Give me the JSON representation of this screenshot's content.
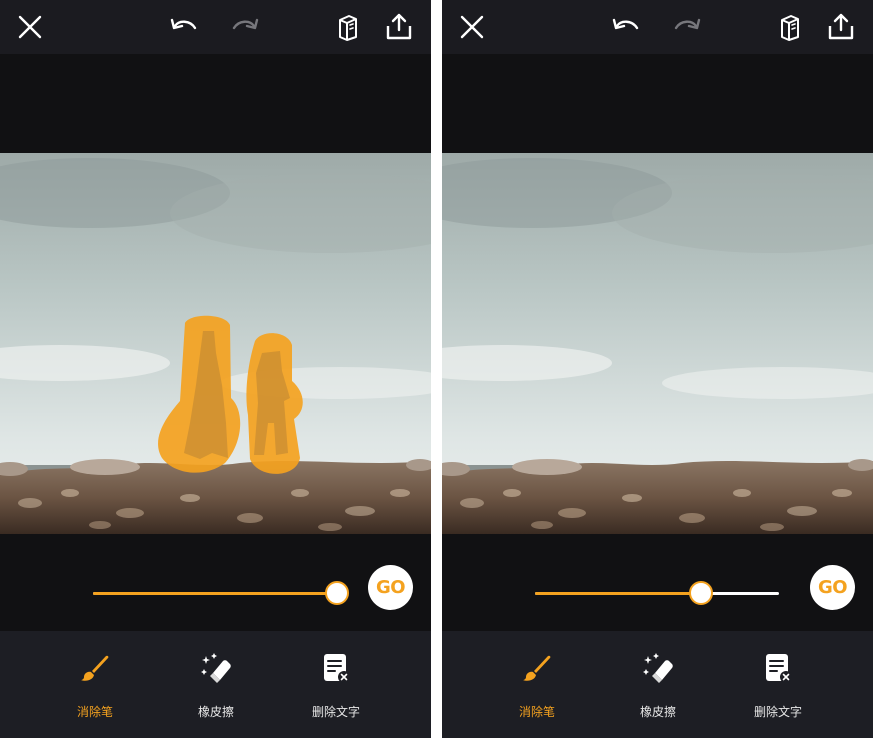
{
  "colors": {
    "accent": "#f4a21f",
    "toolbar_bg": "#1d1e24",
    "topbar_bg": "#1b1b20",
    "canvas_bg": "#111113"
  },
  "icons": {
    "close": "close-icon",
    "undo": "undo-icon",
    "redo": "redo-icon",
    "compare": "book-compare-icon",
    "share": "share-upload-icon",
    "brush": "brush-icon",
    "eraser": "eraser-magic-icon",
    "text": "remove-text-icon"
  },
  "panels": [
    {
      "go_label": "GO",
      "slider_fraction": 1.0,
      "tools": [
        {
          "label": "消除笔",
          "active": true
        },
        {
          "label": "橡皮擦",
          "active": false
        },
        {
          "label": "删除文字",
          "active": false
        }
      ]
    },
    {
      "go_label": "GO",
      "slider_fraction": 0.68,
      "tools": [
        {
          "label": "消除笔",
          "active": true
        },
        {
          "label": "橡皮擦",
          "active": false
        },
        {
          "label": "删除文字",
          "active": false
        }
      ]
    }
  ]
}
